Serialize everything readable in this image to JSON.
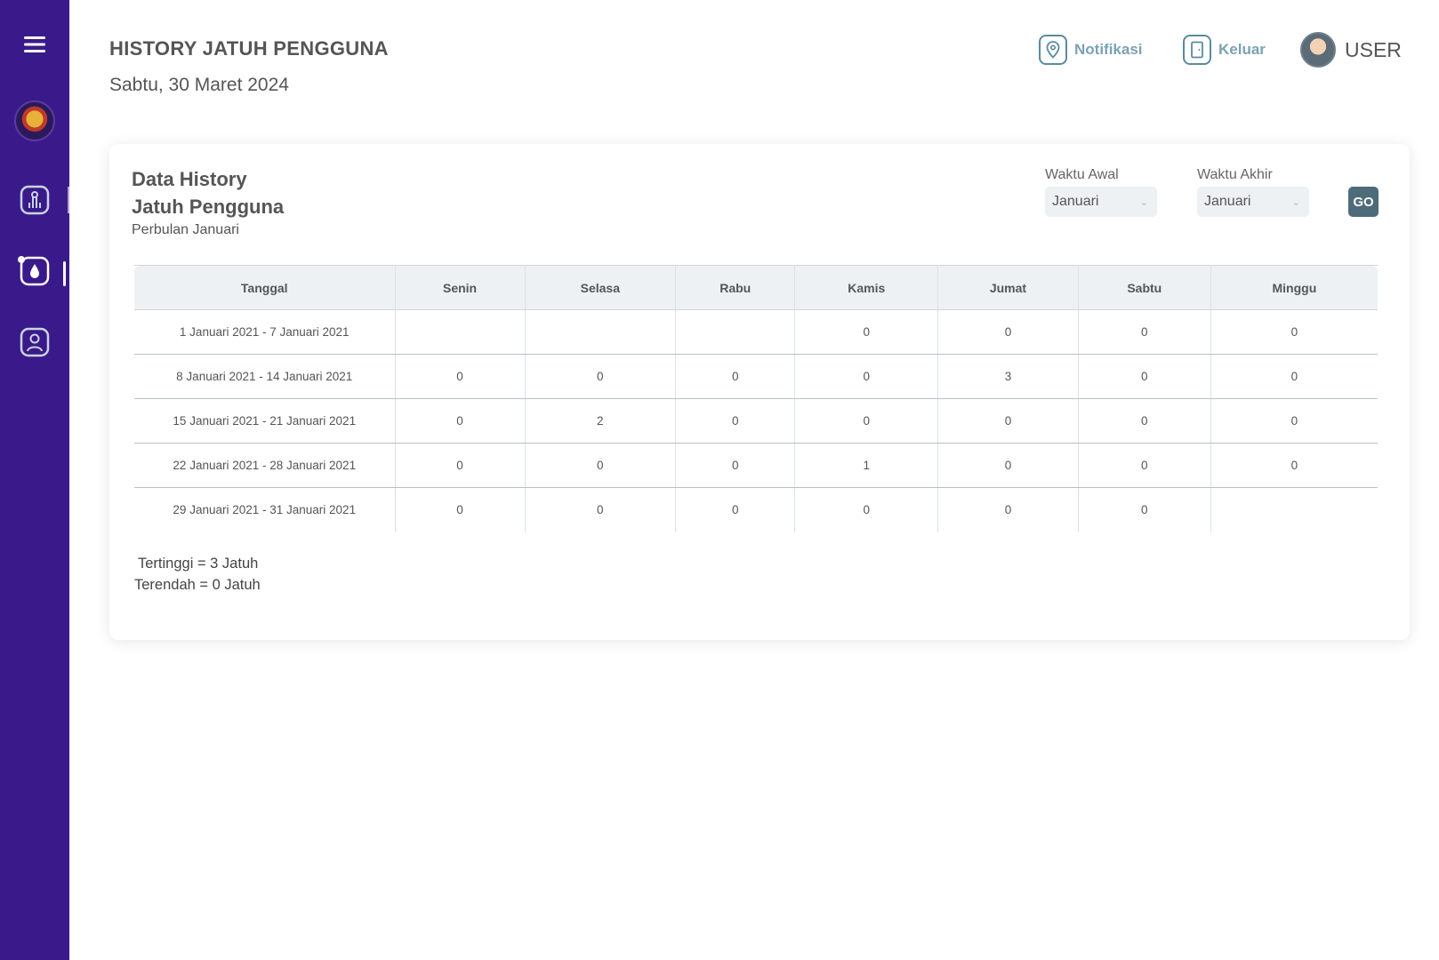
{
  "header": {
    "title": "HISTORY JATUH PENGGUNA",
    "date": "Sabtu, 30 Maret 2024",
    "notifications_label": "Notifikasi",
    "logout_label": "Keluar",
    "user_label": "USER"
  },
  "sidebar": {
    "items": [
      {
        "name": "menu",
        "icon": "hamburger-icon"
      },
      {
        "name": "logo",
        "icon": "emblem-logo"
      },
      {
        "name": "home",
        "icon": "hand-tap-icon"
      },
      {
        "name": "history",
        "icon": "water-drop-icon",
        "active": true
      },
      {
        "name": "profile",
        "icon": "user-icon"
      }
    ]
  },
  "card": {
    "title_line1": "Data History",
    "title_line2": "Jatuh Pengguna",
    "subtitle": "Perbulan Januari",
    "filters": {
      "start_label": "Waktu Awal",
      "start_value": "Januari",
      "end_label": "Waktu Akhir",
      "end_value": "Januari",
      "go_label": "GO"
    },
    "table": {
      "columns": [
        "Tanggal",
        "Senin",
        "Selasa",
        "Rabu",
        "Kamis",
        "Jumat",
        "Sabtu",
        "Minggu"
      ],
      "rows": [
        [
          "1 Januari 2021 - 7 Januari 2021",
          "",
          "",
          "",
          "0",
          "0",
          "0",
          "0"
        ],
        [
          "8 Januari 2021 - 14 Januari 2021",
          "0",
          "0",
          "0",
          "0",
          "3",
          "0",
          "0"
        ],
        [
          "15 Januari 2021 - 21 Januari 2021",
          "0",
          "2",
          "0",
          "0",
          "0",
          "0",
          "0"
        ],
        [
          "22 Januari 2021 - 28 Januari 2021",
          "0",
          "0",
          "0",
          "1",
          "0",
          "0",
          "0"
        ],
        [
          "29 Januari 2021 - 31 Januari 2021",
          "0",
          "0",
          "0",
          "0",
          "0",
          "0",
          ""
        ]
      ]
    },
    "summary": {
      "highest": "Tertinggi = 3 Jatuh",
      "lowest": "Terendah = 0 Jatuh"
    }
  },
  "colors": {
    "sidebar": "#3a1a8a",
    "go_button": "#4e6b7a",
    "icon_accent": "#5a8aa0"
  }
}
